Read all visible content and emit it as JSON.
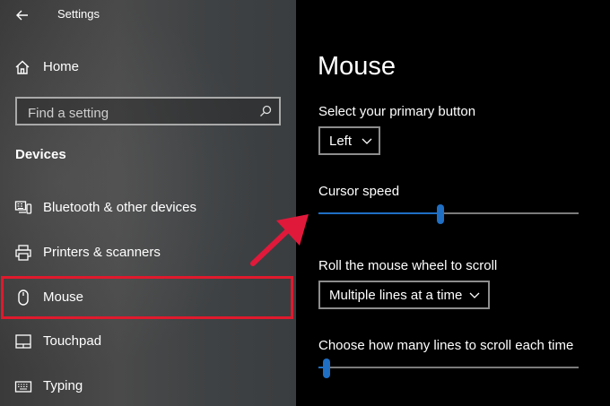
{
  "app": {
    "title": "Settings"
  },
  "sidebar": {
    "home_label": "Home",
    "search_placeholder": "Find a setting",
    "section_title": "Devices",
    "items": [
      {
        "label": "Bluetooth & other devices",
        "icon": "bluetooth-devices-icon"
      },
      {
        "label": "Printers & scanners",
        "icon": "printer-icon"
      },
      {
        "label": "Mouse",
        "icon": "mouse-icon",
        "selected": true
      },
      {
        "label": "Touchpad",
        "icon": "touchpad-icon"
      },
      {
        "label": "Typing",
        "icon": "keyboard-icon"
      }
    ]
  },
  "main": {
    "title": "Mouse",
    "primary_button": {
      "label": "Select your primary button",
      "value": "Left"
    },
    "cursor_speed": {
      "label": "Cursor speed",
      "value_fraction": 0.47
    },
    "scroll_wheel": {
      "label": "Roll the mouse wheel to scroll",
      "value": "Multiple lines at a time"
    },
    "scroll_lines": {
      "label": "Choose how many lines to scroll each time",
      "value_fraction": 0.03
    }
  },
  "colors": {
    "accent": "#1f6fc4",
    "highlight": "#e0192d",
    "arrow": "#e0193b"
  }
}
